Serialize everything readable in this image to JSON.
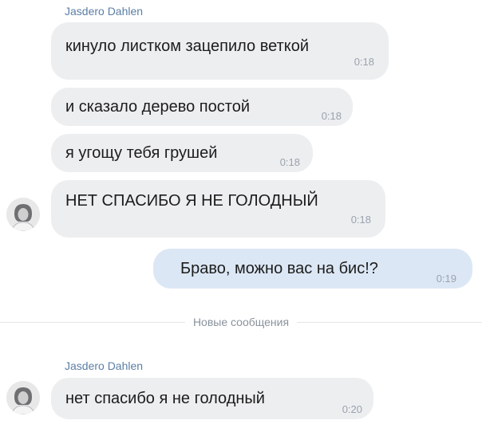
{
  "messages": [
    {
      "sender": "Jasdero Dahlen"
    },
    {
      "text": "кинуло листком зацепило веткой",
      "time": "0:18"
    },
    {
      "text": "и сказало дерево постой",
      "time": "0:18"
    },
    {
      "text": "я угощу тебя грушей",
      "time": "0:18"
    },
    {
      "text": "НЕТ СПАСИБО Я НЕ ГОЛОДНЫЙ",
      "time": "0:18"
    },
    {
      "text": "Браво, можно вас на бис!?",
      "time": "0:19"
    },
    {
      "divider": "Новые сообщения"
    },
    {
      "sender": "Jasdero Dahlen"
    },
    {
      "text": "нет спасибо я не голодный",
      "time": "0:20"
    }
  ],
  "colors": {
    "incoming_bubble": "#edeef0",
    "outgoing_bubble": "#dce7f5",
    "sender_name": "#5b7ea6",
    "timestamp": "#9aa3ad"
  }
}
